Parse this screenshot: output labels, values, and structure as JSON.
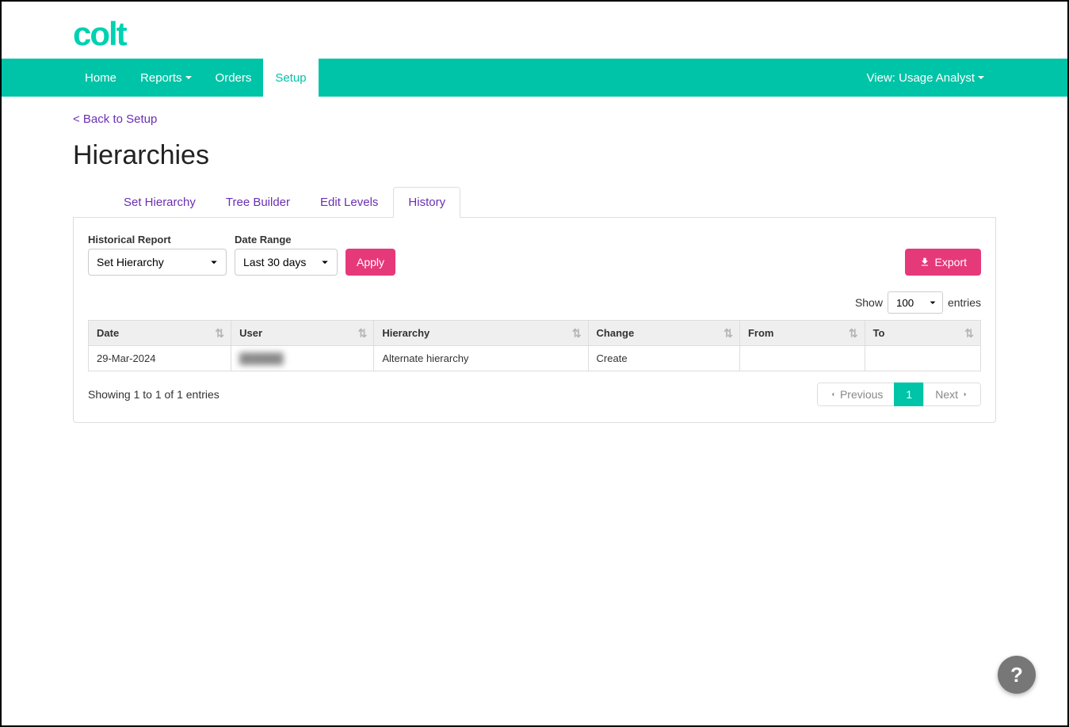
{
  "logo": "colt",
  "nav": {
    "items": [
      "Home",
      "Reports",
      "Orders",
      "Setup"
    ],
    "active": "Setup",
    "view_label": "View: Usage Analyst"
  },
  "back_link": "< Back to Setup",
  "page_title": "Hierarchies",
  "tabs": [
    "Set Hierarchy",
    "Tree Builder",
    "Edit Levels",
    "History"
  ],
  "active_tab": "History",
  "filters": {
    "report_label": "Historical Report",
    "report_value": "Set Hierarchy",
    "range_label": "Date Range",
    "range_value": "Last 30 days",
    "apply_label": "Apply",
    "export_label": "Export"
  },
  "table_controls": {
    "show_label": "Show",
    "show_value": "100",
    "entries_label": "entries"
  },
  "table": {
    "headers": [
      "Date",
      "User",
      "Hierarchy",
      "Change",
      "From",
      "To"
    ],
    "rows": [
      {
        "date": "29-Mar-2024",
        "user": "██████",
        "hierarchy": "Alternate hierarchy",
        "change": "Create",
        "from": "",
        "to": ""
      }
    ]
  },
  "footer": {
    "info": "Showing 1 to 1 of 1 entries",
    "previous": "Previous",
    "next": "Next",
    "current_page": "1"
  },
  "help": "?"
}
